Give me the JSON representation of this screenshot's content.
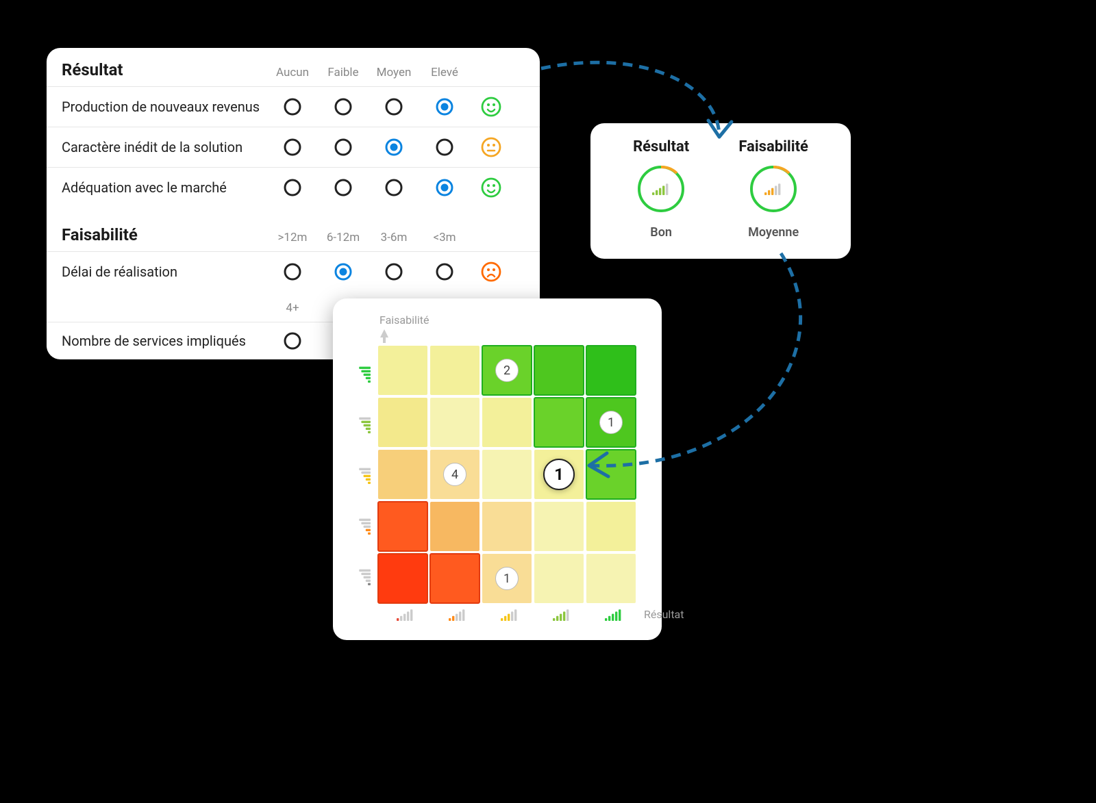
{
  "ratings": {
    "resultat": {
      "title": "Résultat",
      "scale": [
        "Aucun",
        "Faible",
        "Moyen",
        "Elevé"
      ],
      "rows": [
        {
          "label": "Production de nouveaux revenus",
          "selected": 3,
          "mood": "happy",
          "mood_color": "#2ecc40"
        },
        {
          "label": "Caractère inédit de la solution",
          "selected": 2,
          "mood": "neutral",
          "mood_color": "#f5a623"
        },
        {
          "label": "Adéquation avec le marché",
          "selected": 3,
          "mood": "happy",
          "mood_color": "#2ecc40"
        }
      ]
    },
    "faisabilite": {
      "title": "Faisabilité",
      "scale": [
        ">12m",
        "6-12m",
        "3-6m",
        "<3m"
      ],
      "rows": [
        {
          "label": "Délai de réalisation",
          "selected": 1,
          "mood": "sad",
          "mood_color": "#ff6a00"
        }
      ],
      "scale2": [
        "4+"
      ],
      "rows2": [
        {
          "label": "Nombre de services impliqués",
          "selected": null,
          "mood": null
        }
      ]
    }
  },
  "summary": {
    "resultat": {
      "title": "Résultat",
      "label": "Bon",
      "bars_color": "#8cc63f",
      "ring_color": "#2ecc40",
      "gap_color": "#f5a623",
      "level": 4
    },
    "faisabilite": {
      "title": "Faisabilité",
      "label": "Moyenne",
      "bars_color": "#f5a623",
      "ring_color": "#2ecc40",
      "gap_color": "#f5a623",
      "level": 3
    }
  },
  "chart_data": {
    "type": "heatmap",
    "xlabel": "Résultat",
    "ylabel": "Faisabilité",
    "axis_levels": 5,
    "x_tick_colors": [
      "#e74c3c",
      "#ff8c1a",
      "#f5c518",
      "#8cc63f",
      "#2ecc40"
    ],
    "y_tick_colors": [
      "#2ecc40",
      "#8cc63f",
      "#f5c518",
      "#ff8c1a",
      "#888888"
    ],
    "cells_top_to_bottom": [
      [
        "#f3f09a",
        "#f3f09a",
        "#6ad22a",
        "#4ec71f",
        "#2fbf1a"
      ],
      [
        "#f3e98c",
        "#f6f3b2",
        "#f3f09a",
        "#6ad22a",
        "#4ec71f"
      ],
      [
        "#f7cf7a",
        "#f9dd96",
        "#f6f3b2",
        "#f3f09a",
        "#6ad22a"
      ],
      [
        "#ff5a1f",
        "#f7b861",
        "#f9dd96",
        "#f6f3b2",
        "#f3f09a"
      ],
      [
        "#ff3b0f",
        "#ff5a1f",
        "#f9dd96",
        "#f6f3b2",
        "#f6f3b2"
      ]
    ],
    "green_border_cells": [
      [
        0,
        2
      ],
      [
        0,
        3
      ],
      [
        0,
        4
      ],
      [
        1,
        3
      ],
      [
        1,
        4
      ],
      [
        2,
        4
      ]
    ],
    "red_border_cells": [
      [
        3,
        0
      ],
      [
        4,
        0
      ],
      [
        4,
        1
      ]
    ],
    "bubbles": [
      {
        "row": 0,
        "col": 2,
        "value": 2,
        "emphasis": false
      },
      {
        "row": 1,
        "col": 4,
        "value": 1,
        "emphasis": false
      },
      {
        "row": 2,
        "col": 1,
        "value": 4,
        "emphasis": false
      },
      {
        "row": 2,
        "col": 3,
        "value": 1,
        "emphasis": true
      },
      {
        "row": 4,
        "col": 2,
        "value": 1,
        "emphasis": false
      }
    ]
  },
  "colors": {
    "arrow": "#1d6fa5"
  }
}
